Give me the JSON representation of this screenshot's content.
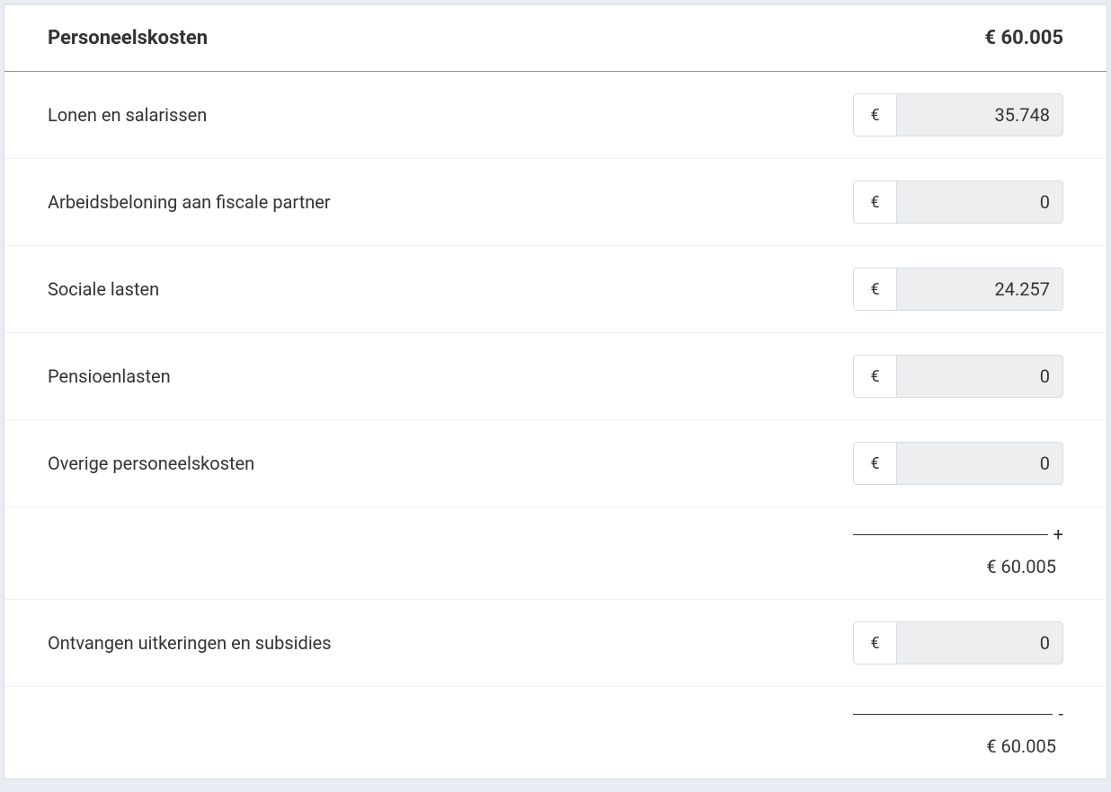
{
  "header": {
    "title": "Personeelskosten",
    "total": "€ 60.005"
  },
  "currency_symbol": "€",
  "rows": [
    {
      "label": "Lonen en salarissen",
      "value": "35.748"
    },
    {
      "label": "Arbeidsbeloning aan fiscale partner",
      "value": "0"
    },
    {
      "label": "Sociale lasten",
      "value": "24.257"
    },
    {
      "label": "Pensioenlasten",
      "value": "0"
    },
    {
      "label": "Overige personeelskosten",
      "value": "0"
    }
  ],
  "subtotal": {
    "operator": "+",
    "value": "€ 60.005"
  },
  "deduction_row": {
    "label": "Ontvangen uitkeringen en subsidies",
    "value": "0"
  },
  "final_total": {
    "operator": "-",
    "value": "€ 60.005"
  }
}
